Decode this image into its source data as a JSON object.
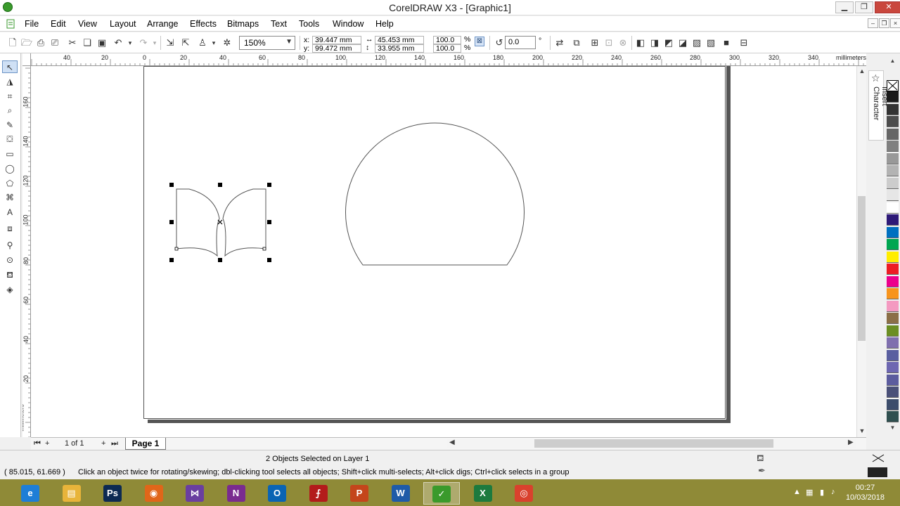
{
  "window": {
    "title": "CorelDRAW X3 - [Graphic1]",
    "minimize_label": "▁",
    "restore_label": "❐",
    "close_label": "✕"
  },
  "menu": {
    "items": [
      "File",
      "Edit",
      "View",
      "Layout",
      "Arrange",
      "Effects",
      "Bitmaps",
      "Text",
      "Tools",
      "Window",
      "Help"
    ],
    "doc_minimize": "–",
    "doc_restore": "❐",
    "doc_close": "×"
  },
  "toolbar": {
    "zoom_value": "150%",
    "x_label": "x:",
    "y_label": "y:",
    "x_value": "39.447 mm",
    "y_value": "99.472 mm",
    "width_value": "45.453 mm",
    "height_value": "33.955 mm",
    "scale_x": "100.0",
    "scale_y": "100.0",
    "percent_symbol": "%",
    "rotation_value": "0.0",
    "degree_symbol": "°"
  },
  "ruler": {
    "unit": "millimeters",
    "top_ticks": [
      "40",
      "20",
      "0",
      "20",
      "40",
      "60",
      "80",
      "100",
      "120",
      "140",
      "160",
      "180",
      "200",
      "220",
      "240",
      "260",
      "280",
      "300",
      "320",
      "340"
    ],
    "left_ticks": [
      "160",
      "140",
      "120",
      "100",
      "80",
      "60",
      "40",
      "20"
    ],
    "left_unit": "millimeters"
  },
  "docker": {
    "label": "Insert Character"
  },
  "palette": {
    "colors": [
      "#1a1a1a",
      "#333333",
      "#4d4d4d",
      "#666666",
      "#808080",
      "#999999",
      "#b3b3b3",
      "#cccccc",
      "#e6e6e6",
      "#ffffff",
      "#2e1a78",
      "#0070c0",
      "#00a651",
      "#ffed00",
      "#ed1c24",
      "#ec008c",
      "#f7941d",
      "#f49ac1",
      "#8b6f47",
      "#6b8e23",
      "#7f6fae",
      "#5a5fa0",
      "#6e67b1",
      "#5c5c9e",
      "#4a5078",
      "#3d4d6b",
      "#2f4f4f"
    ]
  },
  "pagebar": {
    "page_count": "1 of 1",
    "page_tab": "Page 1"
  },
  "status": {
    "selection": "2 Objects Selected on Layer 1",
    "coords": "( 85.015, 61.669 )",
    "hint": "Click an object twice for rotating/skewing; dbl-clicking tool selects all objects; Shift+click multi-selects; Alt+click digs; Ctrl+click selects in a group"
  },
  "taskbar": {
    "apps": [
      {
        "name": "ie",
        "label": "e",
        "color": "#1e7ed6"
      },
      {
        "name": "explorer",
        "label": "▤",
        "color": "#e8b43a"
      },
      {
        "name": "photoshop",
        "label": "Ps",
        "color": "#0d2a52"
      },
      {
        "name": "firefox",
        "label": "◉",
        "color": "#e06619"
      },
      {
        "name": "visual-studio",
        "label": "⋈",
        "color": "#6a3fa0"
      },
      {
        "name": "onenote",
        "label": "N",
        "color": "#7a2b8f"
      },
      {
        "name": "outlook",
        "label": "O",
        "color": "#0a64b4"
      },
      {
        "name": "acrobat",
        "label": "⨍",
        "color": "#b31b1b"
      },
      {
        "name": "powerpoint",
        "label": "P",
        "color": "#c4451b"
      },
      {
        "name": "word",
        "label": "W",
        "color": "#1f5ba8"
      },
      {
        "name": "coreldraw",
        "label": "✓",
        "color": "#3a9a2c"
      },
      {
        "name": "excel",
        "label": "X",
        "color": "#1d7a3e"
      },
      {
        "name": "chrome",
        "label": "◎",
        "color": "#d9412d"
      }
    ],
    "time": "00:27",
    "date": "10/03/2018"
  }
}
